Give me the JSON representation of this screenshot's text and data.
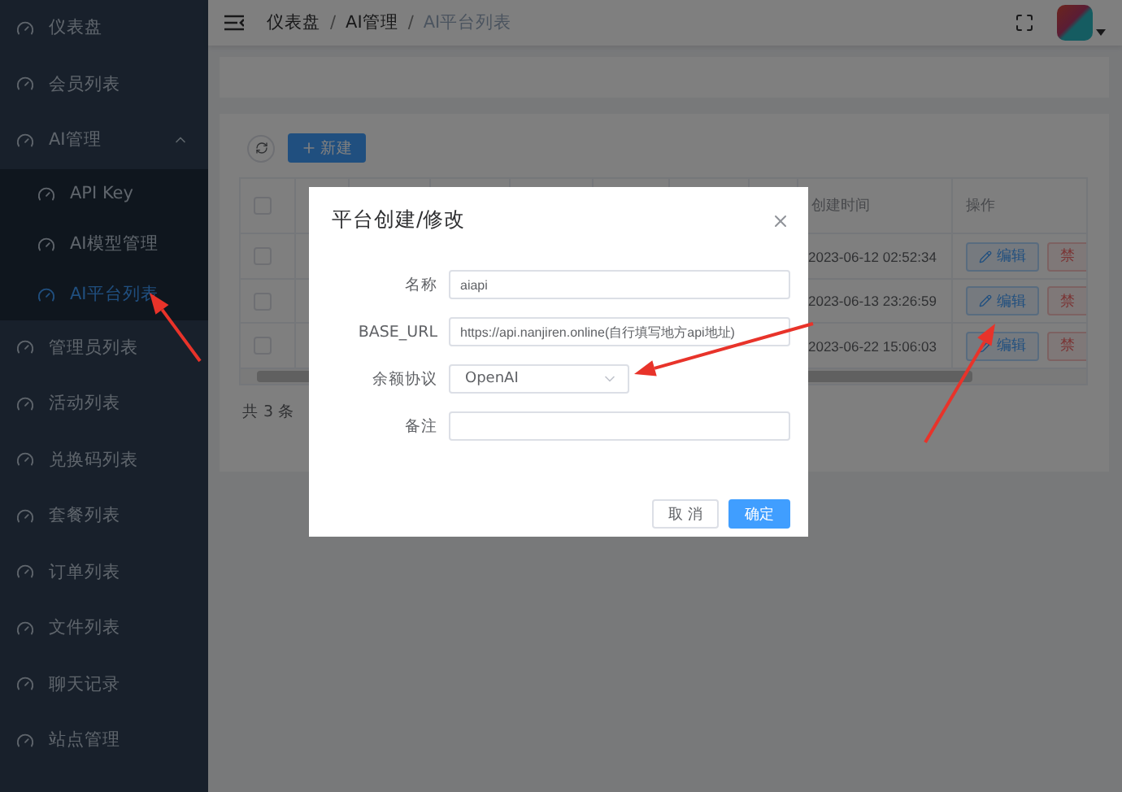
{
  "sidebar": {
    "items": [
      {
        "label": "仪表盘",
        "kind": "link",
        "selected": false
      },
      {
        "label": "会员列表",
        "kind": "link",
        "selected": false
      },
      {
        "label": "AI管理",
        "kind": "group",
        "selected": false,
        "expanded": true,
        "children": [
          {
            "label": "API Key",
            "selected": false
          },
          {
            "label": "AI模型管理",
            "selected": false
          },
          {
            "label": "AI平台列表",
            "selected": true
          }
        ]
      },
      {
        "label": "管理员列表",
        "kind": "link",
        "selected": false
      },
      {
        "label": "活动列表",
        "kind": "link",
        "selected": false
      },
      {
        "label": "兑换码列表",
        "kind": "link",
        "selected": false
      },
      {
        "label": "套餐列表",
        "kind": "link",
        "selected": false
      },
      {
        "label": "订单列表",
        "kind": "link",
        "selected": false
      },
      {
        "label": "文件列表",
        "kind": "link",
        "selected": false
      },
      {
        "label": "聊天记录",
        "kind": "link",
        "selected": false
      },
      {
        "label": "站点管理",
        "kind": "link",
        "selected": false
      }
    ]
  },
  "breadcrumb": [
    "仪表盘",
    "AI管理",
    "AI平台列表"
  ],
  "breadcrumb_separator": "/",
  "toolbar": {
    "new_button": "新建"
  },
  "table": {
    "all_checked": false,
    "columns": [
      {
        "label": "创建时间"
      },
      {
        "label": "操作"
      }
    ],
    "rows": [
      {
        "checked": false,
        "created": "2023-06-12 02:52:34",
        "actions": [
          "编辑",
          "禁"
        ]
      },
      {
        "checked": false,
        "created": "2023-06-13 23:26:59",
        "actions": [
          "编辑",
          "禁"
        ]
      },
      {
        "checked": false,
        "created": "2023-06-22 15:06:03",
        "actions": [
          "编辑",
          "禁"
        ]
      }
    ]
  },
  "footer": {
    "total": "共 3 条"
  },
  "dialog": {
    "title": "平台创建/修改",
    "fields": [
      {
        "label": "名称",
        "kind": "input",
        "value": "aiapi"
      },
      {
        "label": "BASE_URL",
        "kind": "input",
        "value": "https://api.nanjiren.online(自行填写地方api地址)"
      },
      {
        "label": "余额协议",
        "kind": "select",
        "value": "OpenAI"
      },
      {
        "label": "备注",
        "kind": "input"
      }
    ],
    "buttons": [
      {
        "label": "取 消",
        "kind": "default"
      },
      {
        "label": "确定",
        "kind": "primary"
      }
    ]
  }
}
